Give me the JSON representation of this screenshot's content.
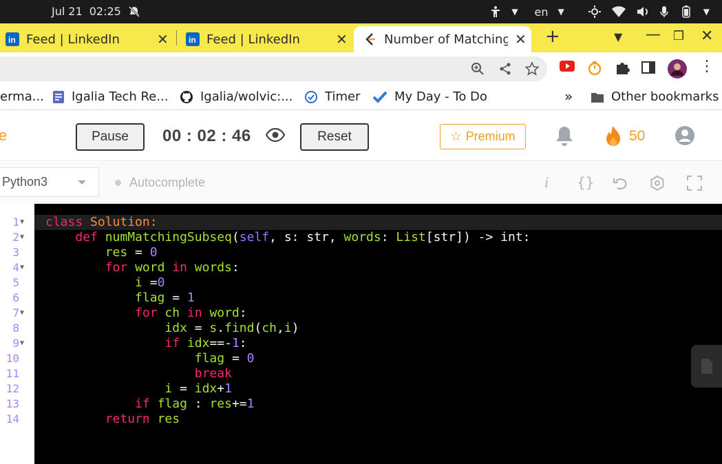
{
  "system": {
    "date": "Jul 21",
    "time": "02:25",
    "keyboard_layout": "en"
  },
  "tabs": [
    {
      "title": "Feed | LinkedIn",
      "favicon": "linkedin-icon",
      "active": false
    },
    {
      "title": "Feed | LinkedIn",
      "favicon": "linkedin-icon",
      "active": false
    },
    {
      "title": "Number of Matching",
      "favicon": "leetcode-icon",
      "active": true
    }
  ],
  "bookmarks": {
    "items": [
      {
        "label": "erma..."
      },
      {
        "label": "Igalia Tech Re..."
      },
      {
        "label": "Igalia/wolvic:..."
      },
      {
        "label": "Timer"
      },
      {
        "label": "My Day - To Do"
      }
    ],
    "overflow": "»",
    "other": "Other bookmarks"
  },
  "header": {
    "left_fragment": "e",
    "pause_label": "Pause",
    "timer": "00 : 02 : 46",
    "reset_label": "Reset",
    "premium_label": "Premium",
    "streak_count": "50"
  },
  "editor_bar": {
    "language": "Python3",
    "autocomplete": "Autocomplete",
    "tools": [
      "info-icon",
      "braces-icon",
      "undo-icon",
      "settings-icon",
      "fullscreen-icon"
    ]
  },
  "code": {
    "line_numbers": [
      "1",
      "2",
      "3",
      "4",
      "5",
      "6",
      "7",
      "8",
      "9",
      "10",
      "11",
      "12",
      "13",
      "14"
    ],
    "folds": [
      1,
      2,
      4,
      7,
      9
    ]
  },
  "colors": {
    "chrome_accent": "#f7e94b",
    "premium": "#f0a020",
    "editor_bg": "#000000"
  }
}
